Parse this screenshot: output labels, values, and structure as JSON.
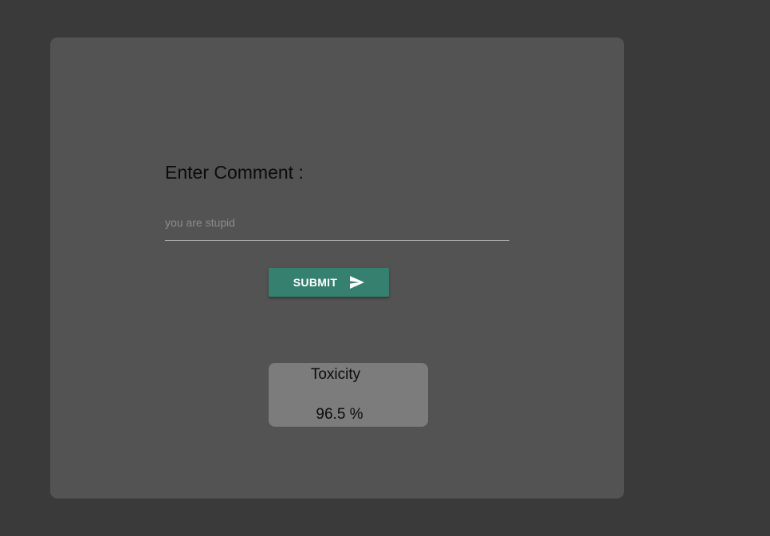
{
  "form": {
    "label": "Enter Comment :",
    "input_value": "",
    "input_placeholder": "you are stupid",
    "submit_label": "SUBMIT",
    "submit_icon": "send-icon"
  },
  "result": {
    "title": "Toxicity",
    "value": "96.5 %"
  },
  "colors": {
    "page_background": "#3a3a3a",
    "card_background": "#535353",
    "accent": "#35806f",
    "result_background": "#7c7c7c"
  }
}
